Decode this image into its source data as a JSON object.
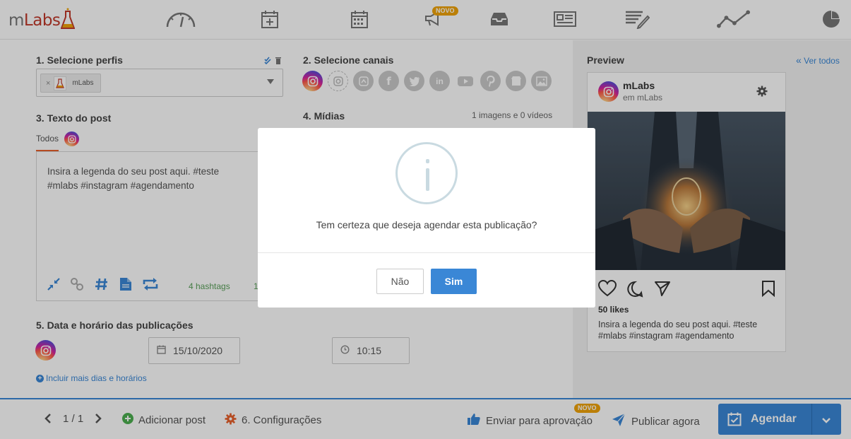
{
  "brand": {
    "logo_text": "mLabs",
    "accent": "#3a87d6",
    "warning": "#f0a30a",
    "logo_color": "#c0392b"
  },
  "nav": {
    "items": [
      {
        "name": "dashboard",
        "icon": "gauge-icon"
      },
      {
        "name": "new-post",
        "icon": "calendar-plus-icon"
      },
      {
        "name": "calendar",
        "icon": "calendar-icon"
      },
      {
        "name": "ads",
        "icon": "megaphone-icon",
        "badge": "NOVO"
      },
      {
        "name": "inbox",
        "icon": "inbox-icon"
      },
      {
        "name": "reports",
        "icon": "newspaper-icon"
      },
      {
        "name": "workflow",
        "icon": "edit-list-icon"
      },
      {
        "name": "analytics",
        "icon": "line-chart-icon"
      },
      {
        "name": "more",
        "icon": "pie-chart-icon"
      }
    ]
  },
  "step1": {
    "title": "1. Selecione perfis",
    "chip_label": "mLabs",
    "chip_remove": "×"
  },
  "step2": {
    "title": "2. Selecione canais"
  },
  "step3": {
    "title": "3. Texto do post",
    "tab": "Todos",
    "text": "Insira a legenda do seu post aqui. #teste #mlabs #instagram #agendamento",
    "hashtags": "4 hashtags",
    "counter_fragment": "1"
  },
  "step4": {
    "title": "4. Mídias",
    "count": "1 imagens e 0 vídeos"
  },
  "step5": {
    "title": "5. Data e horário das publicações",
    "date": "15/10/2020",
    "time": "10:15",
    "add_more": "Incluir mais dias e horários"
  },
  "preview": {
    "title": "Preview",
    "ver_todos": "Ver todos",
    "account_name": "mLabs",
    "account_sub": "em mLabs",
    "likes": "50 likes",
    "caption": "Insira a legenda do seu post aqui. #teste #mlabs #instagram #agendamento"
  },
  "bottom": {
    "pager": "1 / 1",
    "add_post": "Adicionar post",
    "settings": "6. Configurações",
    "approval": "Enviar para aprovação",
    "approval_badge": "NOVO",
    "publish_now": "Publicar agora",
    "schedule": "Agendar"
  },
  "modal": {
    "message": "Tem certeza que deseja agendar esta publicação?",
    "no": "Não",
    "yes": "Sim"
  }
}
